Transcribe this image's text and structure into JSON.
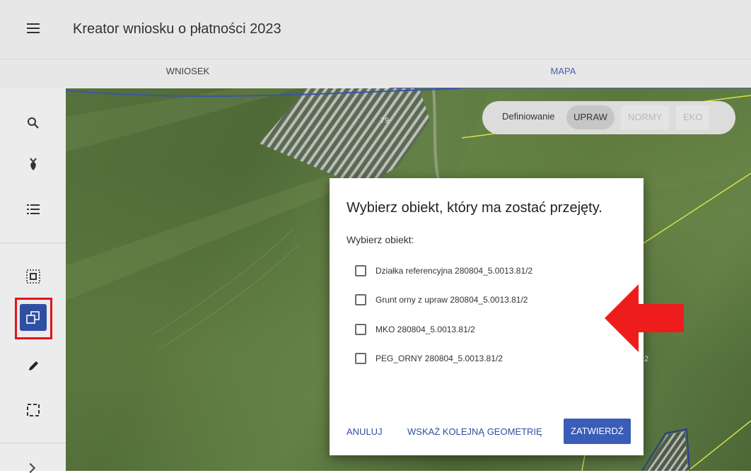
{
  "header": {
    "title": "Kreator wniosku o płatności 2023",
    "menu_icon": "hamburger-menu-icon"
  },
  "tabs": [
    {
      "label": "WNIOSEK",
      "active": false
    },
    {
      "label": "MAPA",
      "active": true
    }
  ],
  "toolbar": {
    "tools": [
      {
        "name": "search-icon",
        "active": false
      },
      {
        "name": "crop-plant-icon",
        "active": false
      },
      {
        "name": "list-icon",
        "active": false
      },
      {
        "name": "select-object-icon",
        "active": false
      },
      {
        "name": "take-over-geometry-icon",
        "active": true
      },
      {
        "name": "pencil-edit-icon",
        "active": false
      },
      {
        "name": "draw-rectangle-icon",
        "active": false
      }
    ]
  },
  "map": {
    "parcel_labels": [
      "79",
      "2"
    ]
  },
  "mode_switch": {
    "label": "Definiowanie",
    "options": [
      "UPRAW",
      "NORMY",
      "EKO"
    ],
    "selected": "UPRAW"
  },
  "dialog": {
    "title": "Wybierz obiekt, który ma zostać przejęty.",
    "subtitle": "Wybierz obiekt:",
    "options": [
      "Działka referencyjna 280804_5.0013.81/2",
      "Grunt orny z upraw 280804_5.0013.81/2",
      "MKO 280804_5.0013.81/2",
      "PEG_ORNY 280804_5.0013.81/2"
    ],
    "buttons": {
      "cancel": "ANULUJ",
      "next": "WSKAŻ KOLEJNĄ GEOMETRIĘ",
      "confirm": "ZATWIERDŹ"
    }
  },
  "colors": {
    "accent": "#2f4fa3",
    "highlight": "#e4141b",
    "arrow": "#ee1c1c"
  }
}
